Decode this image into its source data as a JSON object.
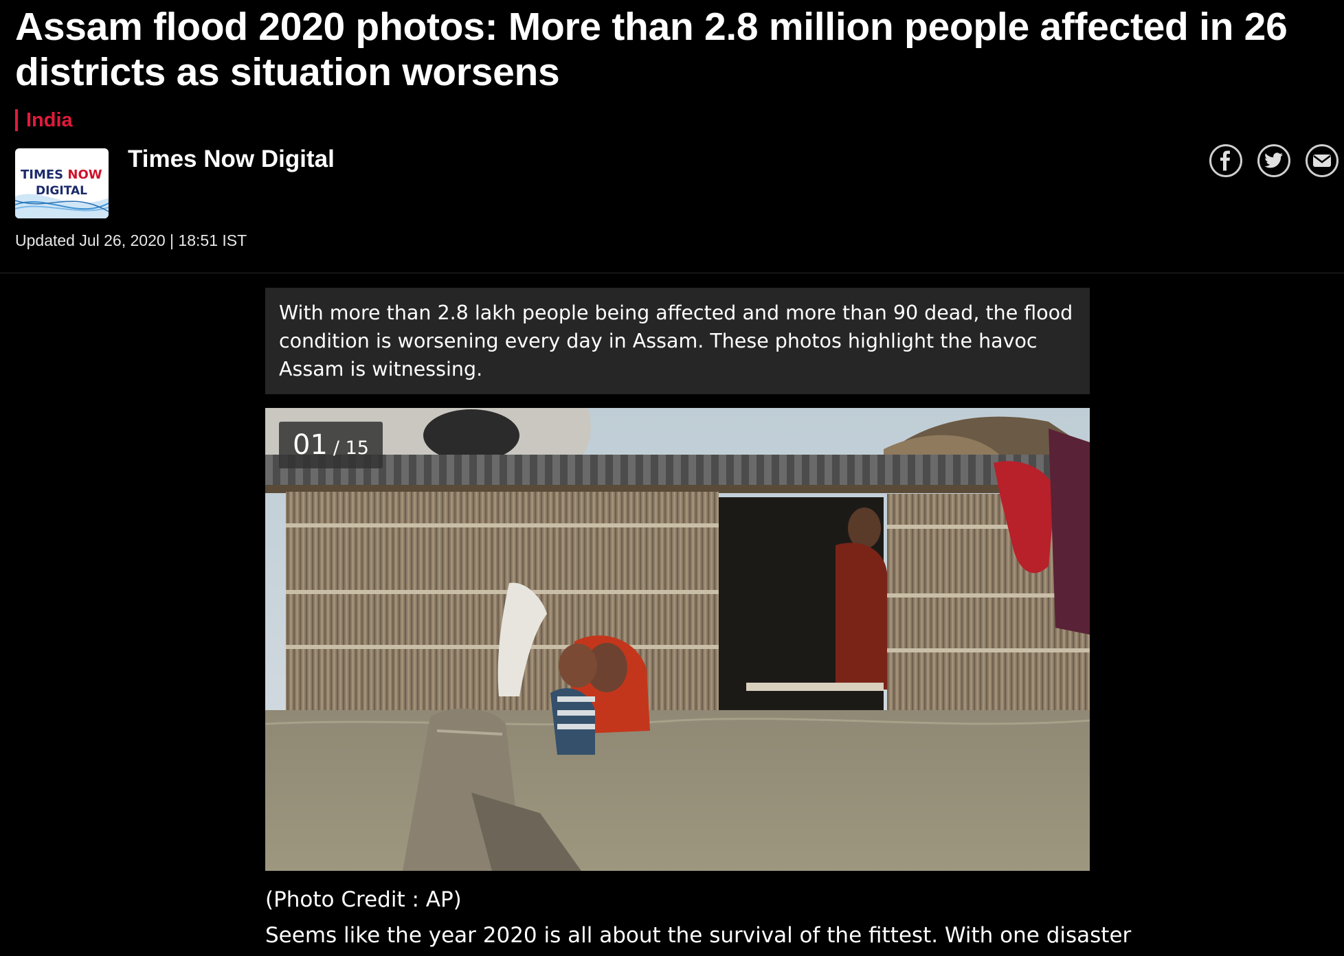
{
  "article": {
    "headline": "Assam flood 2020 photos: More than 2.8 million people affected in 26 districts as situation worsens",
    "category": "India",
    "author": {
      "name": "Times Now Digital",
      "logo_line1_a": "TIMES ",
      "logo_line1_b": "NOW",
      "logo_line2": "DIGITAL"
    },
    "updated": "Updated Jul 26, 2020 | 18:51 IST",
    "summary": "With more than 2.8 lakh people being affected and more than 90 dead, the flood condition is worsening every day in Assam. These photos highlight the havoc Assam is witnessing.",
    "gallery": {
      "current": "01",
      "total": "/ 15"
    },
    "photo_credit": "(Photo Credit : AP)",
    "body_start": "Seems like the year 2020 is all about the survival of the fittest. With one disaster"
  },
  "share": {
    "icons": [
      "facebook-icon",
      "twitter-icon",
      "email-icon"
    ]
  },
  "colors": {
    "accent": "#e21b3c",
    "background": "#000000",
    "summary_bg": "#262626"
  }
}
